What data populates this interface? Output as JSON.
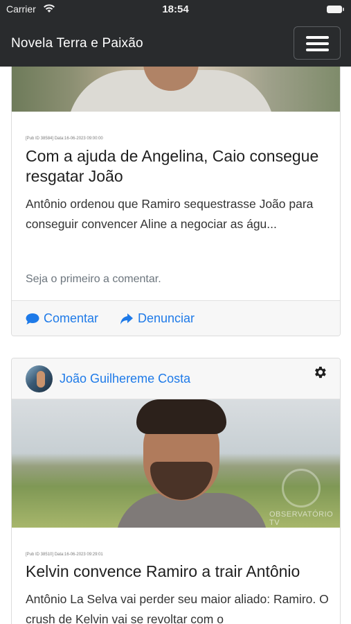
{
  "status_bar": {
    "carrier": "Carrier",
    "time": "18:54"
  },
  "navbar": {
    "title": "Novela Terra e Paixão"
  },
  "posts": [
    {
      "pub_meta": "[Pub ID 38584] Data:16-06-2023 09:00:00",
      "title": "Com a ajuda de Angelina, Caio consegue resgatar João",
      "excerpt": "Antônio ordenou que Ramiro  sequestrasse João para conseguir convencer Aline  a negociar as águ...",
      "comments_hint": "Seja o primeiro a comentar.",
      "comment_label": "Comentar",
      "report_label": "Denunciar"
    },
    {
      "author": "João Guilhereme Costa",
      "pub_meta": "[Pub ID 38510] Data:16-06-2023 09:29:01",
      "title": "Kelvin convence Ramiro a trair Antônio",
      "excerpt": "Antônio La Selva  vai perder seu maior aliado: Ramiro. O crush de Kelvin  vai se revoltar com o",
      "watermark": "OBSERVATÓRIO TV"
    }
  ],
  "colors": {
    "navbar_bg": "#292b2d",
    "link": "#1e7ae8",
    "footer_bg": "#f7f7f7"
  },
  "icons": [
    "wifi-icon",
    "battery-icon",
    "hamburger-menu-icon",
    "comment-icon",
    "share-icon",
    "gear-icon"
  ]
}
